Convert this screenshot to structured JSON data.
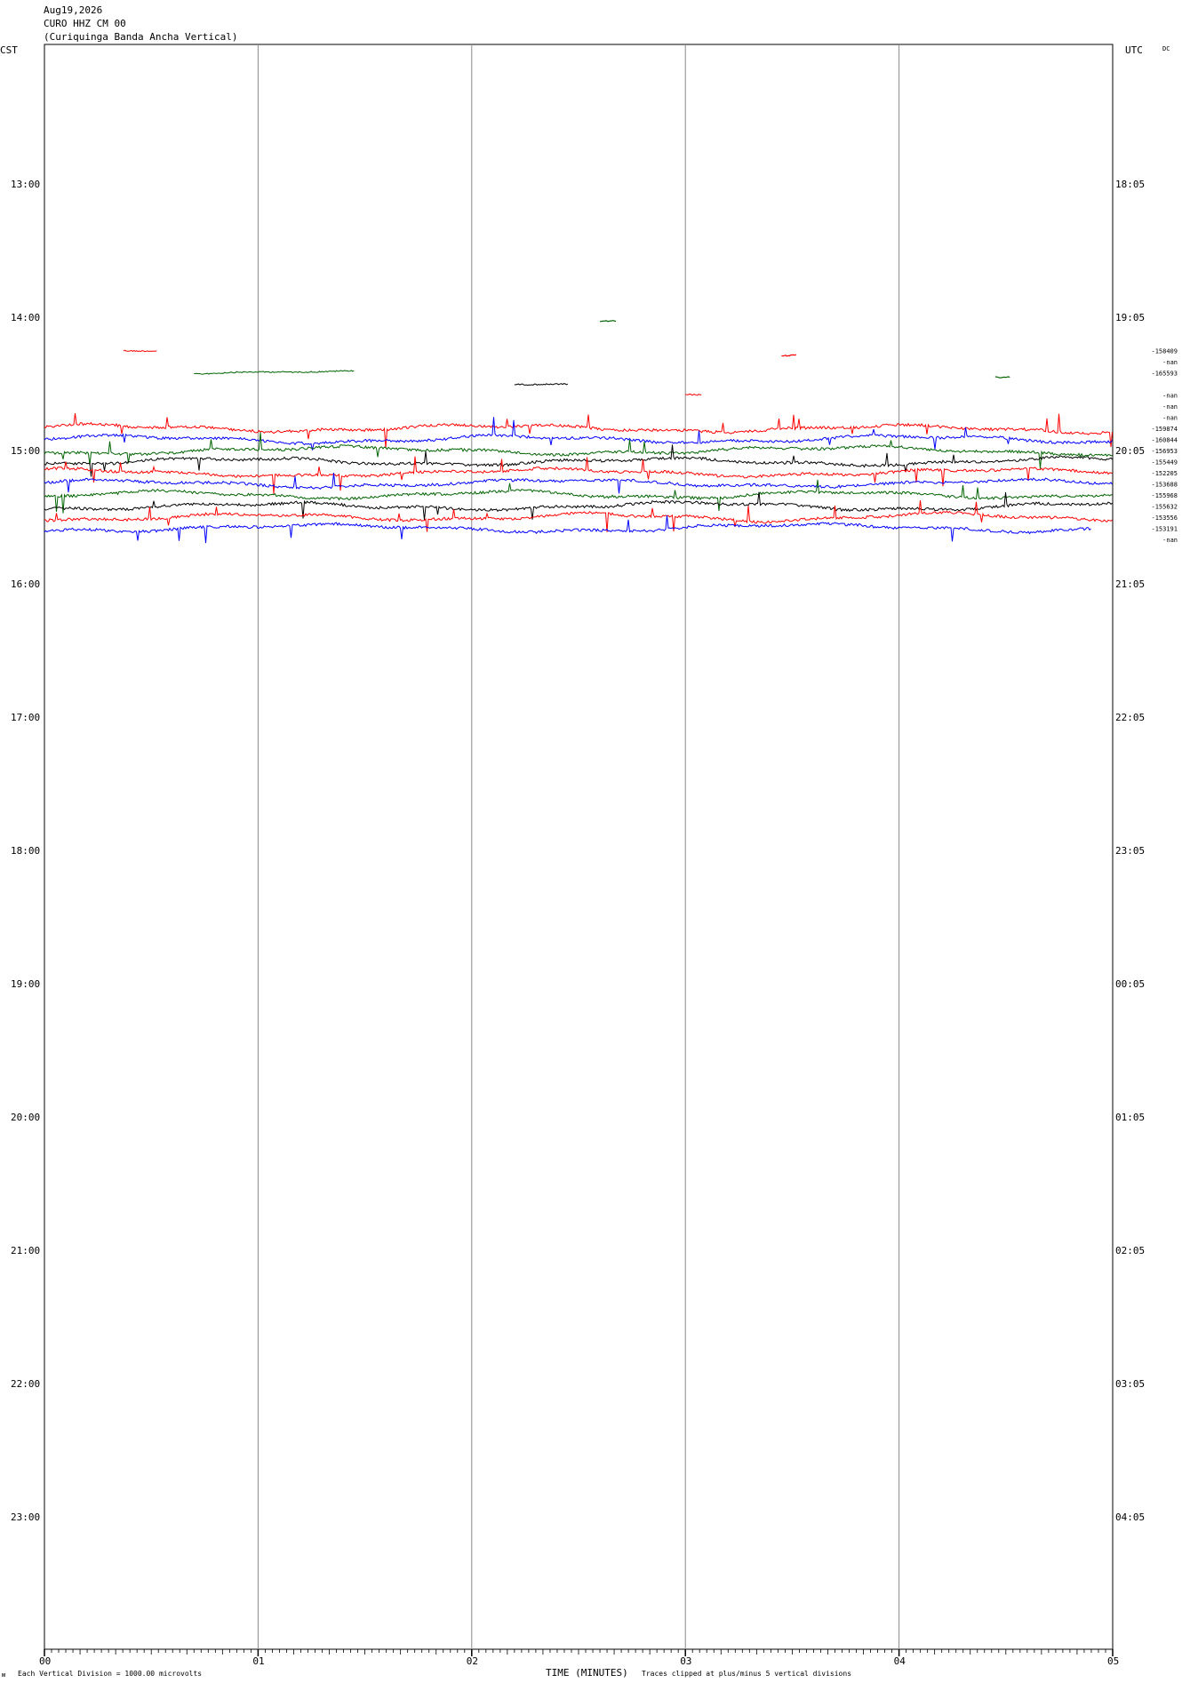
{
  "header": {
    "date": "Aug19,2026",
    "station": "CURO HHZ CM 00",
    "description": "(Curiquinga Banda Ancha Vertical)"
  },
  "chart_data": {
    "type": "line",
    "title": "CURO HHZ CM 00",
    "left_timezone": "CST",
    "right_timezone": "UTC",
    "corner_label": "DC",
    "xlabel": "TIME (MINUTES)",
    "x_ticks": [
      "00",
      "01",
      "02",
      "03",
      "04",
      "05"
    ],
    "xlim": [
      0,
      5
    ],
    "left_time_labels": [
      "13:00",
      "14:00",
      "15:00",
      "16:00",
      "17:00",
      "18:00",
      "19:00",
      "20:00",
      "21:00",
      "22:00",
      "23:00"
    ],
    "right_time_labels": [
      "18:05",
      "19:05",
      "20:05",
      "21:05",
      "22:05",
      "23:05",
      "00:05",
      "01:05",
      "02:05",
      "03:05",
      "04:05"
    ],
    "footer_left": "Each Vertical Division = 1000.00 microvolts",
    "footer_right": "Traces clipped at plus/minus 5 vertical divisions",
    "trace_colors": [
      "#ff0000",
      "#0000ff",
      "#006400",
      "#000000"
    ],
    "traces": [
      {
        "row": 27,
        "color": "#ff0000",
        "x_start": 0.37,
        "x_end": 0.53,
        "rms": "-158409"
      },
      {
        "row": 28,
        "color": "#0000ff",
        "x_start": 0,
        "x_end": 0,
        "rms": "-nan"
      },
      {
        "row": 29,
        "color": "#006400",
        "x_start": 0.7,
        "x_end": 1.45,
        "rms": "-165593"
      },
      {
        "row": 30,
        "color": "#000000",
        "x_start": 2.2,
        "x_end": 2.45,
        "rms": ""
      },
      {
        "row": 31,
        "color": "#ff0000",
        "x_start": 3.0,
        "x_end": 3.08,
        "rms": "-nan"
      },
      {
        "row": 32,
        "color": "#0000ff",
        "x_start": 0,
        "x_end": 0,
        "rms": "-nan"
      },
      {
        "row": 33,
        "color": "#006400",
        "x_start": 0,
        "x_end": 0,
        "rms": "-nan"
      },
      {
        "row": 34,
        "color": "#ff0000",
        "x_start": 0,
        "x_end": 5,
        "rms": "-159874"
      },
      {
        "row": 35,
        "color": "#0000ff",
        "x_start": 0,
        "x_end": 5,
        "rms": "-160844"
      },
      {
        "row": 36,
        "color": "#006400",
        "x_start": 0,
        "x_end": 5,
        "rms": "-156953"
      },
      {
        "row": 37,
        "color": "#000000",
        "x_start": 0,
        "x_end": 5,
        "rms": "-155449"
      },
      {
        "row": 38,
        "color": "#ff0000",
        "x_start": 0,
        "x_end": 5,
        "rms": "-152205"
      },
      {
        "row": 39,
        "color": "#0000ff",
        "x_start": 0,
        "x_end": 5,
        "rms": "-153688"
      },
      {
        "row": 40,
        "color": "#006400",
        "x_start": 0,
        "x_end": 5,
        "rms": "-155968"
      },
      {
        "row": 41,
        "color": "#000000",
        "x_start": 0,
        "x_end": 5,
        "rms": "-155632"
      },
      {
        "row": 42,
        "color": "#ff0000",
        "x_start": 0,
        "x_end": 5,
        "rms": "-153556"
      },
      {
        "row": 43,
        "color": "#0000ff",
        "x_start": 0,
        "x_end": 4.9,
        "rms": "-153191"
      },
      {
        "row": 44,
        "color": "#000000",
        "x_start": 0,
        "x_end": 0,
        "rms": "-nan"
      }
    ],
    "fragments": [
      {
        "color": "#006400",
        "x_start": 2.6,
        "x_end": 2.68,
        "after_row": 24
      },
      {
        "color": "#ff0000",
        "x_start": 3.45,
        "x_end": 3.52,
        "after_row": 27
      },
      {
        "color": "#006400",
        "x_start": 4.45,
        "x_end": 4.52,
        "after_row": 29
      }
    ],
    "grid": "vertical-minute-lines",
    "legend": "none"
  }
}
